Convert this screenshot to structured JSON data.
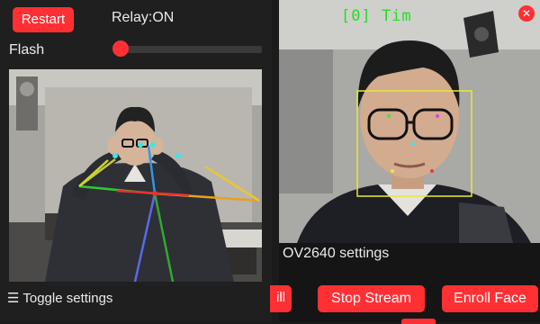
{
  "left_panel": {
    "restart_label": "Restart",
    "relay_status": "Relay:ON",
    "flash_label": "Flash",
    "flash_level": 0,
    "toggle_icon": "☰",
    "toggle_label": "Toggle settings"
  },
  "right_panel": {
    "face_label": "[0] Tim",
    "close_icon": "close-icon",
    "settings_title": "OV2640 settings",
    "partial_button_label": "ill",
    "stop_stream_label": "Stop Stream",
    "enroll_face_label": "Enroll Face"
  },
  "colors": {
    "accent_red": "#ff3034",
    "face_box": "#e8e83a",
    "label_green": "#22e022",
    "panel_bg": "#1f1f1f"
  }
}
